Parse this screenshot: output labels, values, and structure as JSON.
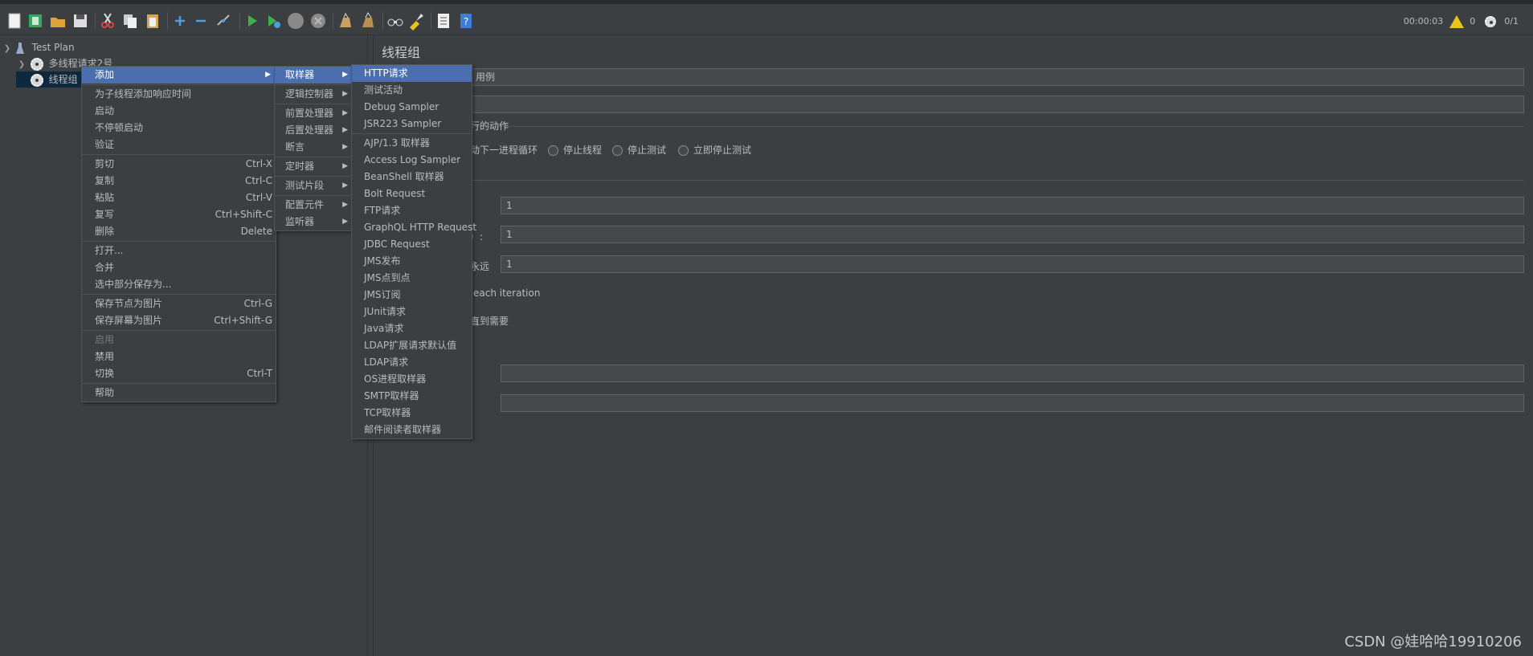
{
  "toolbar": {
    "timer": "00:00:03",
    "warning_count": "0",
    "thread_ratio": "0/1"
  },
  "tree": {
    "test_plan": "Test Plan",
    "node1": "多线程请求2号",
    "node2": "线程组"
  },
  "right": {
    "title": "线程组",
    "name_value": "用例",
    "error_action_label": "行的动作",
    "radio_next_loop": "动下一进程循环",
    "radio_stop_thread": "停止线程",
    "radio_stop_test": "停止测试",
    "radio_stop_now": "立即停止测试",
    "threads_value": "1",
    "rampup_label": "）:",
    "rampup_value": "1",
    "loop_label": "永远",
    "loop_value": "1",
    "same_user_label": "each iteration",
    "delay_label": "直到需要"
  },
  "menu_main": {
    "add": "添加",
    "add_response_time": "为子线程添加响应时间",
    "start": "启动",
    "start_no_pause": "不停顿启动",
    "validate": "验证",
    "cut": "剪切",
    "cut_sc": "Ctrl-X",
    "copy": "复制",
    "copy_sc": "Ctrl-C",
    "paste": "粘贴",
    "paste_sc": "Ctrl-V",
    "overwrite": "复写",
    "overwrite_sc": "Ctrl+Shift-C",
    "delete": "删除",
    "delete_sc": "Delete",
    "open": "打开...",
    "merge": "合并",
    "save_selection": "选中部分保存为...",
    "save_node_image": "保存节点为图片",
    "save_node_image_sc": "Ctrl-G",
    "save_screen_image": "保存屏幕为图片",
    "save_screen_image_sc": "Ctrl+Shift-G",
    "enable": "启用",
    "disable": "禁用",
    "toggle": "切换",
    "toggle_sc": "Ctrl-T",
    "help": "帮助"
  },
  "menu_add": [
    "取样器",
    "逻辑控制器",
    "前置处理器",
    "后置处理器",
    "断言",
    "定时器",
    "测试片段",
    "配置元件",
    "监听器"
  ],
  "menu_sampler": [
    "HTTP请求",
    "测试活动",
    "Debug Sampler",
    "JSR223 Sampler",
    "AJP/1.3 取样器",
    "Access Log Sampler",
    "BeanShell 取样器",
    "Bolt Request",
    "FTP请求",
    "GraphQL HTTP Request",
    "JDBC Request",
    "JMS发布",
    "JMS点到点",
    "JMS订阅",
    "JUnit请求",
    "Java请求",
    "LDAP扩展请求默认值",
    "LDAP请求",
    "OS进程取样器",
    "SMTP取样器",
    "TCP取样器",
    "邮件阅读者取样器"
  ],
  "watermark": "CSDN @娃哈哈19910206",
  "colors": {
    "background": "#3c3f41",
    "highlight": "#4b6eaf",
    "warning": "#e8c51b"
  }
}
